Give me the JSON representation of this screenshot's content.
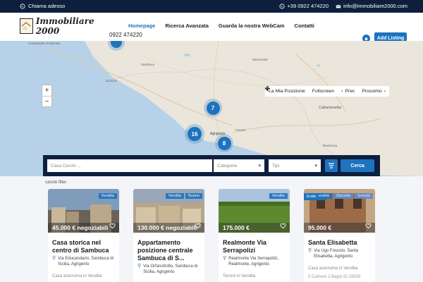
{
  "topbar": {
    "call_label": "Chiama adesso",
    "phone": "+39 0922 474220",
    "email": "info@immobiliare2000.com"
  },
  "header": {
    "logo_text": "Immobiliare 2000",
    "logo_badge": "I2",
    "phone_under": "0922 474220",
    "nav": [
      "Homepage",
      "Ricerca Avanzata",
      "Guarda la nostra WebCam",
      "Contatti"
    ],
    "add_listing": "Add Listing"
  },
  "map": {
    "zoom_in": "+",
    "zoom_out": "−",
    "controls": {
      "my_position": "La Mia Posizione",
      "fullscreen": "Fullscreen",
      "prev": "Prec",
      "next": "Prossimo"
    },
    "clusters": [
      {
        "count": "7"
      },
      {
        "count": "16"
      },
      {
        "count": "8"
      },
      {
        "count": ""
      }
    ],
    "place_labels": [
      "Campobello di Mazara",
      "Sciacca",
      "Caltanissetta",
      "Agrigento",
      "Mussomeli",
      "Favara",
      "Licata",
      "Ravanusa",
      "Sambuca"
    ]
  },
  "search": {
    "text_placeholder": "Casa Cerchi ...",
    "category_placeholder": "Categorie",
    "type_placeholder": "Tipi",
    "submit": "Cerca"
  },
  "cancel_filter": "cancle filter",
  "listings": [
    {
      "badges": [
        "Vendita"
      ],
      "badge_left": "",
      "price": "45.000 € negoziabili",
      "title": "Casa storica nel centro di Sambuca",
      "address": "Via Educandario, Sambuca di Sicilia, Agrigento",
      "category": "Casa autonoma in Vendita",
      "meta": ""
    },
    {
      "badges": [
        "Vendita",
        "Buono"
      ],
      "badge_left": "",
      "price": "130.000 € negoziabili",
      "title": "Appartamento posizione centrale Sambuca di S...",
      "address": "Via Orfanotrofio, Sambuca di Sicilia, Agrigento",
      "category": "",
      "meta": ""
    },
    {
      "badges": [
        "Vendita"
      ],
      "badge_left": "",
      "price": "175.000 €",
      "title": "Realmonte Via Serrapolizi",
      "address": "Realmonte Via Serrapolizi, Realmonte, Agrigento",
      "category": "Terreni in Vendita",
      "meta": ""
    },
    {
      "badges": [
        "endita",
        "Discreto",
        "Grezzo"
      ],
      "badge_left": "Evidenza",
      "price": "95.000 €",
      "title": "Santa Elisabetta",
      "address": "Via Ugo Foscolo, Santa Elisabetta, Agrigento",
      "category": "Casa autonoma in Vendita",
      "meta": "5 Camere  2 Bagni  ID 19829"
    }
  ],
  "colors": {
    "primary": "#1e73be",
    "dark": "#0d1f3c",
    "sea": "#b7d2e8",
    "land": "#eae6dc"
  }
}
